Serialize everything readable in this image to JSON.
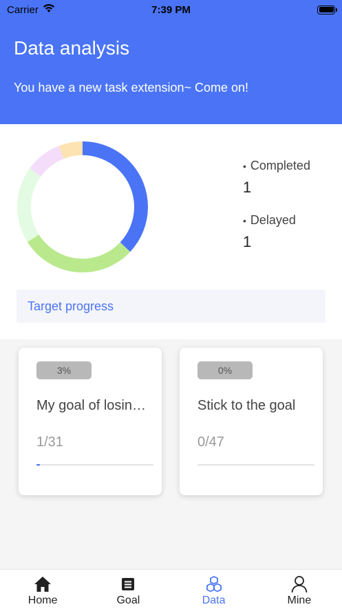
{
  "status_bar": {
    "carrier": "Carrier",
    "time": "7:39 PM"
  },
  "header": {
    "title": "Data analysis",
    "subtitle": "You have a new task extension~ Come on!"
  },
  "chart_data": {
    "type": "pie",
    "style": "donut",
    "slices": [
      {
        "color": "#4a74f5",
        "fraction": 0.37
      },
      {
        "color": "#b9e98c",
        "fraction": 0.29
      },
      {
        "color": "#e3fbe3",
        "fraction": 0.19
      },
      {
        "color": "#f4ddfb",
        "fraction": 0.09
      },
      {
        "color": "#fde2b2",
        "fraction": 0.06
      }
    ]
  },
  "legend": [
    {
      "label": "Completed",
      "value": "1"
    },
    {
      "label": "Delayed",
      "value": "1"
    }
  ],
  "progress_tab": {
    "label": "Target progress"
  },
  "goals": [
    {
      "percent_label": "3%",
      "title": "My goal of losing weight",
      "count": "1/31",
      "progress": 0.03
    },
    {
      "percent_label": "0%",
      "title": "Stick to the goal",
      "count": "0/47",
      "progress": 0.0
    }
  ],
  "tabbar": [
    {
      "label": "Home",
      "icon": "home-icon",
      "active": false
    },
    {
      "label": "Goal",
      "icon": "list-icon",
      "active": false
    },
    {
      "label": "Data",
      "icon": "cubes-icon",
      "active": true
    },
    {
      "label": "Mine",
      "icon": "person-icon",
      "active": false
    }
  ],
  "colors": {
    "accent": "#4a74f5",
    "badge": "#b8b8b8"
  }
}
